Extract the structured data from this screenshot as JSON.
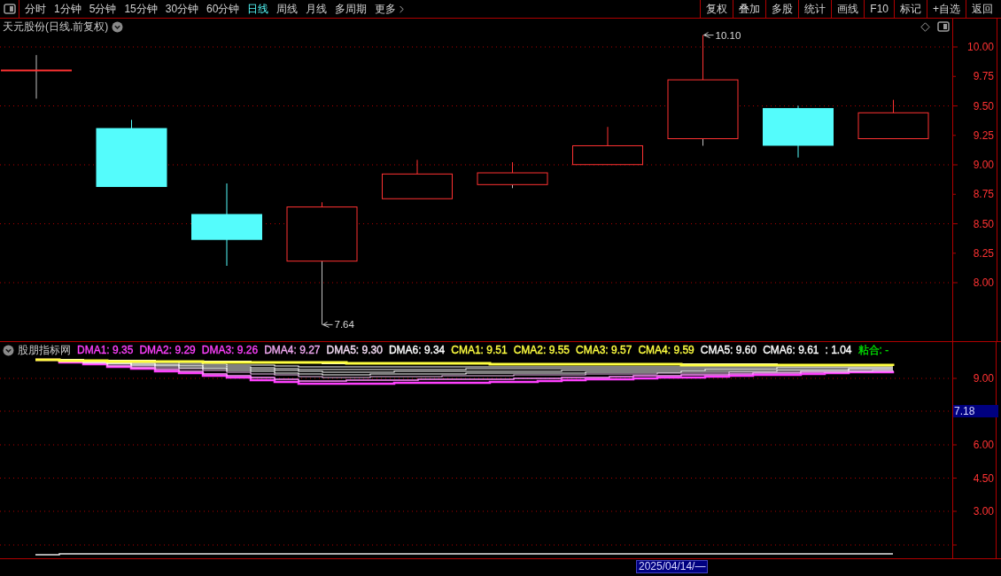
{
  "toolbar": {
    "periods": [
      {
        "label": "分时",
        "selected": false
      },
      {
        "label": "1分钟",
        "selected": false
      },
      {
        "label": "5分钟",
        "selected": false
      },
      {
        "label": "15分钟",
        "selected": false
      },
      {
        "label": "30分钟",
        "selected": false
      },
      {
        "label": "60分钟",
        "selected": false
      },
      {
        "label": "日线",
        "selected": true
      },
      {
        "label": "周线",
        "selected": false
      },
      {
        "label": "月线",
        "selected": false
      },
      {
        "label": "多周期",
        "selected": false
      },
      {
        "label": "更多",
        "selected": false
      }
    ],
    "buttons": [
      "复权",
      "叠加",
      "多股",
      "统计",
      "画线",
      "F10",
      "标记",
      "+自选",
      "返回"
    ]
  },
  "price_panel": {
    "title": "天元股份(日线.前复权)",
    "axis_labels": [
      "10.00",
      "9.75",
      "9.50",
      "9.25",
      "9.00",
      "8.75",
      "8.50",
      "8.25",
      "8.00"
    ],
    "price_marks": [
      "10.10",
      "7.64"
    ]
  },
  "indicator_panel": {
    "name": "股朋指标网",
    "legend": [
      {
        "text": "DMA1: 9.35",
        "color": "#ff40ff"
      },
      {
        "text": "DMA2: 9.29",
        "color": "#ff40ff"
      },
      {
        "text": "DMA3: 9.26",
        "color": "#ff40ff"
      },
      {
        "text": "DMA4: 9.27",
        "color": "#f0a8f0"
      },
      {
        "text": "DMA5: 9.30",
        "color": "#f8e0f8"
      },
      {
        "text": "DMA6: 9.34",
        "color": "#ffffff"
      },
      {
        "text": "CMA1: 9.51",
        "color": "#ffff40"
      },
      {
        "text": "CMA2: 9.55",
        "color": "#ffff40"
      },
      {
        "text": "CMA3: 9.57",
        "color": "#ffff40"
      },
      {
        "text": "CMA4: 9.59",
        "color": "#ffff40"
      },
      {
        "text": "CMA5: 9.60",
        "color": "#ffffff"
      },
      {
        "text": "CMA6: 9.61",
        "color": "#ffffff"
      },
      {
        "text": ": 1.04",
        "color": "#ffffff"
      },
      {
        "text": "粘合: -",
        "color": "#00e000"
      }
    ],
    "axis_labels": [
      "9.00",
      "6.00",
      "4.50",
      "3.00"
    ],
    "cursor_value": "7.18"
  },
  "date_bar": {
    "cursor_date": "2025/04/14/—"
  }
}
